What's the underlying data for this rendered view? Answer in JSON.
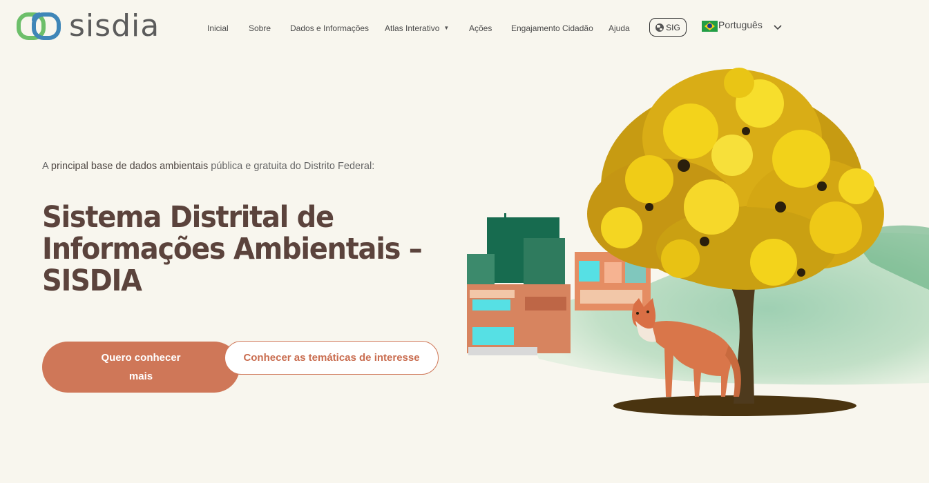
{
  "header": {
    "logo_text": "sisdia",
    "nav": [
      {
        "label": "Inicial"
      },
      {
        "label": "Sobre"
      },
      {
        "label": "Dados e Informações"
      },
      {
        "label": "Atlas Interativo",
        "has_dropdown": true
      },
      {
        "label": "Ações"
      },
      {
        "label": "Engajamento Cidadão"
      },
      {
        "label": "Ajuda"
      }
    ],
    "sig_label": "SIG",
    "language": {
      "label": "Português",
      "flag": "brazil-flag"
    }
  },
  "hero": {
    "tagline_pre": "A ",
    "tagline_bold": "principal base de dados ambientais",
    "tagline_post": " pública e gratuita do Distrito Federal:",
    "title": "Sistema Distrital de Informações Ambientais – SISDIA",
    "primary_button": "Quero conhecer mais",
    "secondary_button": "Conhecer as temáticas de interesse"
  },
  "colors": {
    "background": "#f8f6ee",
    "accent": "#cf7758",
    "title": "#5b433c",
    "logo_green": "#6dbf6a",
    "logo_blue": "#3f86b8"
  },
  "icons": [
    "logo-rings-icon",
    "globe-icon",
    "caret-down-icon",
    "chevron-down-icon",
    "brazil-flag-icon"
  ]
}
